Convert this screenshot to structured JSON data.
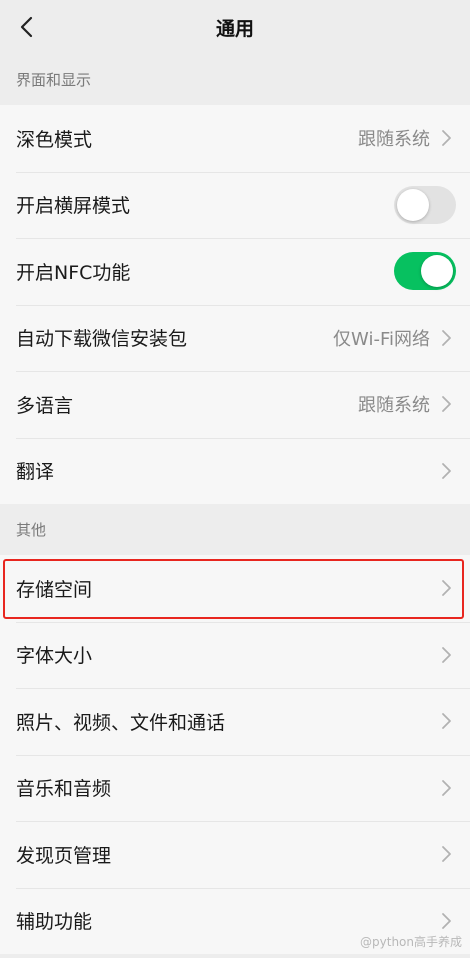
{
  "header": {
    "title": "通用",
    "back_icon": "chevron-left-icon"
  },
  "sections": [
    {
      "title": "界面和显示",
      "items": [
        {
          "label": "深色模式",
          "value": "跟随系统"
        },
        {
          "label": "开启横屏模式",
          "toggle": "off"
        },
        {
          "label": "开启NFC功能",
          "toggle": "on"
        },
        {
          "label": "自动下载微信安装包",
          "value": "仅Wi-Fi网络"
        },
        {
          "label": "多语言",
          "value": "跟随系统"
        },
        {
          "label": "翻译"
        }
      ]
    },
    {
      "title": "其他",
      "items": [
        {
          "label": "存储空间",
          "highlighted": true
        },
        {
          "label": "字体大小"
        },
        {
          "label": "照片、视频、文件和通话"
        },
        {
          "label": "音乐和音频"
        },
        {
          "label": "发现页管理"
        },
        {
          "label": "辅助功能"
        }
      ]
    }
  ],
  "colors": {
    "toggle_on": "#07c160",
    "toggle_off": "#e2e2e2",
    "highlight_border": "#e8261f",
    "background": "#ededed",
    "row_background": "#f7f7f7"
  },
  "watermark": "@python高手养成"
}
